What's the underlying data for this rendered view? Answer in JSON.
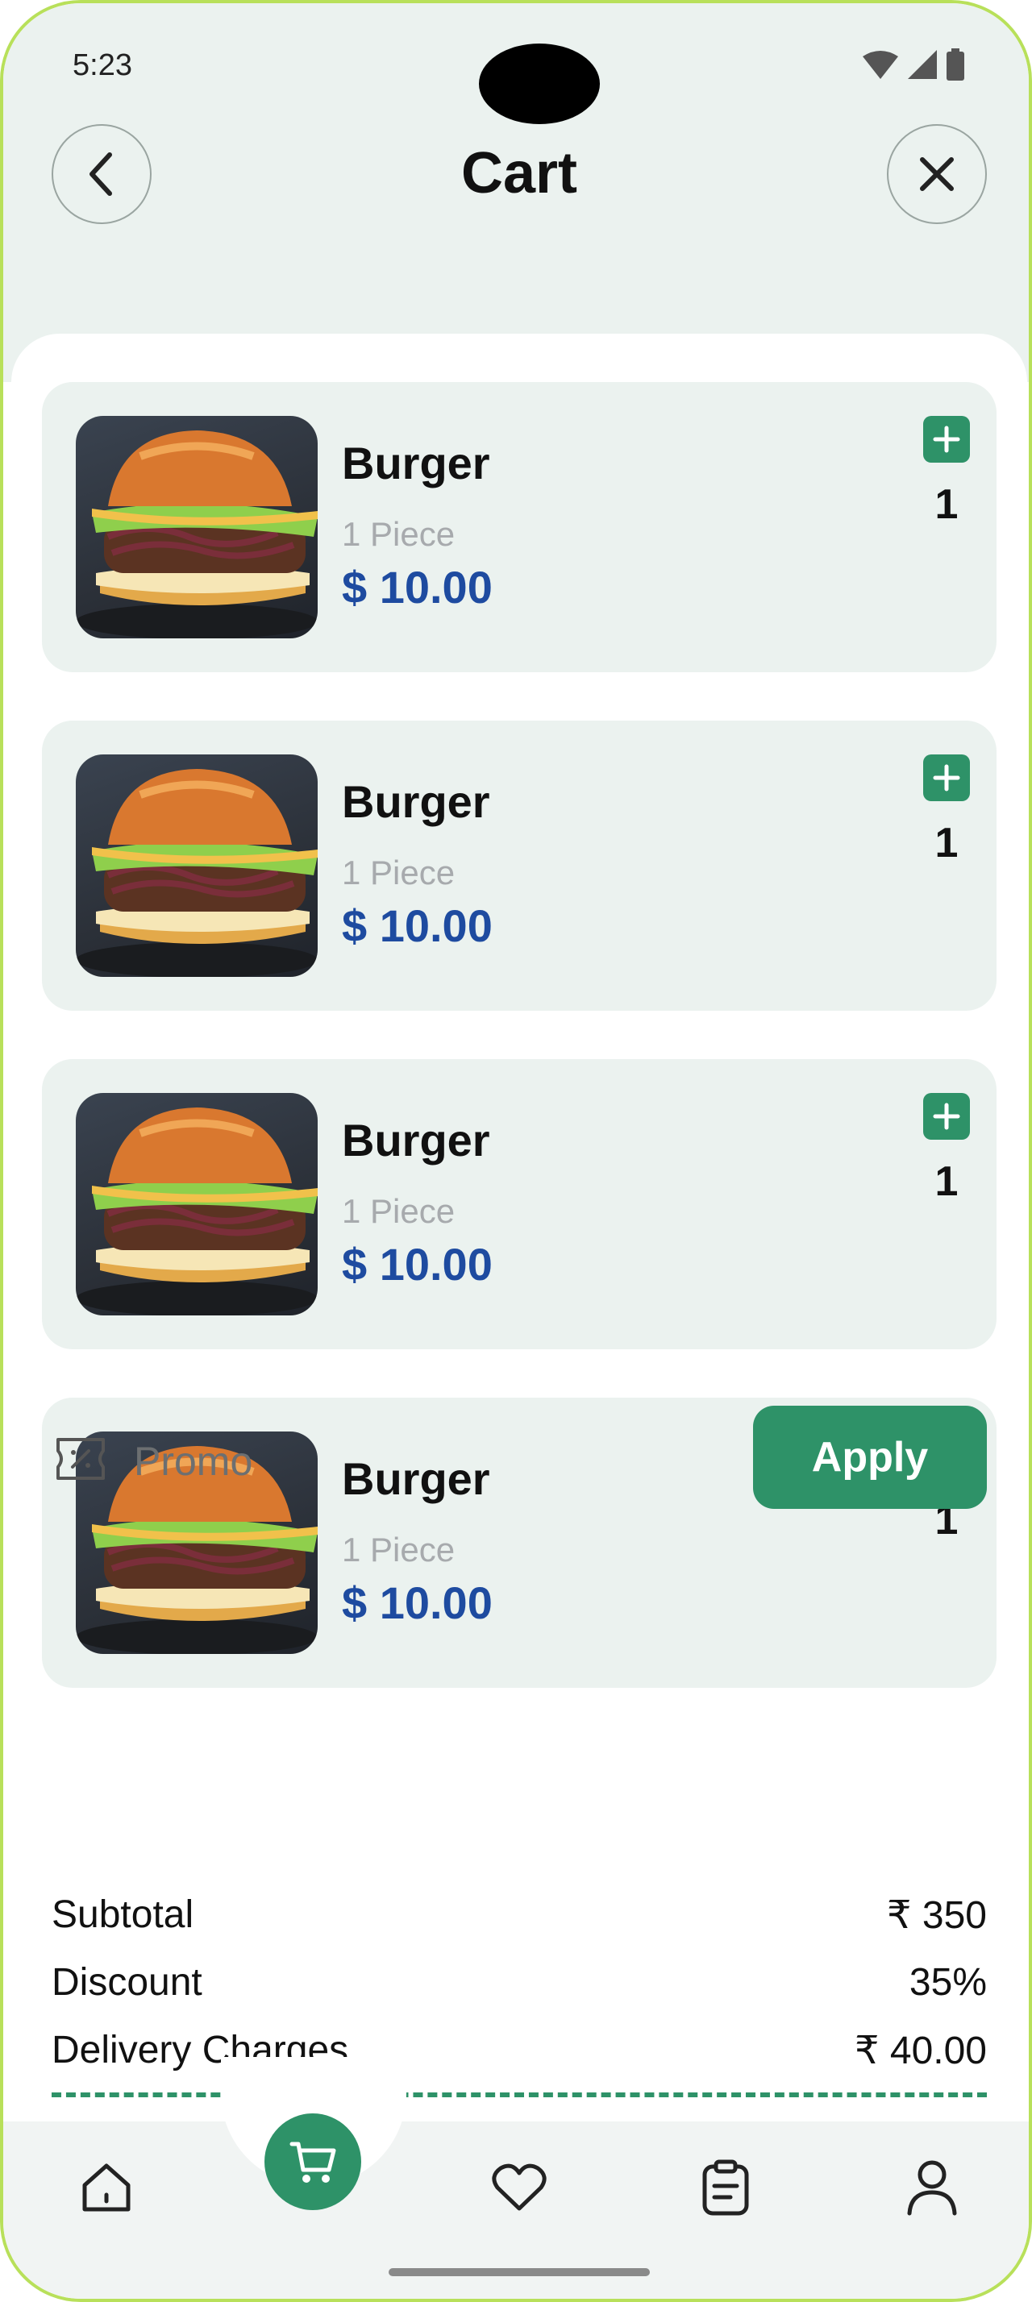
{
  "status_bar": {
    "time": "5:23"
  },
  "header": {
    "title": "Cart"
  },
  "cart_items": [
    {
      "name": "Burger",
      "desc": "1 Piece",
      "price": "$ 10.00",
      "qty": "1"
    },
    {
      "name": "Burger",
      "desc": "1 Piece",
      "price": "$ 10.00",
      "qty": "1"
    },
    {
      "name": "Burger",
      "desc": "1 Piece",
      "price": "$ 10.00",
      "qty": "1"
    },
    {
      "name": "Burger",
      "desc": "1 Piece",
      "price": "$ 10.00",
      "qty": "1"
    }
  ],
  "promo": {
    "label": "Promo",
    "apply_label": "Apply"
  },
  "summary": {
    "subtotal_label": "Subtotal",
    "subtotal_value": "₹ 350",
    "discount_label": "Discount",
    "discount_value": "35%",
    "delivery_label": "Delivery Charges",
    "delivery_value": "₹ 40.00"
  },
  "colors": {
    "accent": "#2e9268",
    "price": "#1e4ba0",
    "background": "#ebf2ef"
  },
  "bottom_nav": [
    "home-icon",
    "cart-icon",
    "heart-icon",
    "orders-icon",
    "profile-icon"
  ]
}
